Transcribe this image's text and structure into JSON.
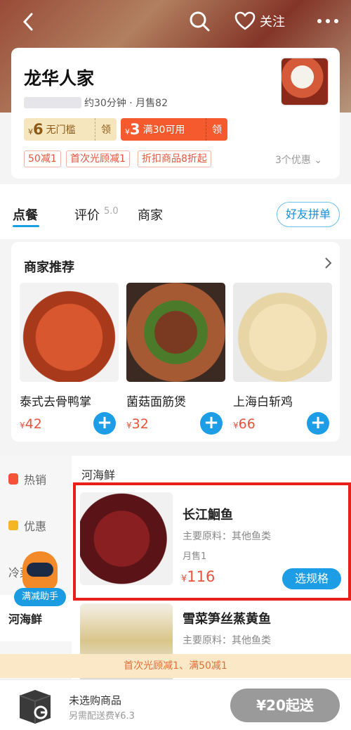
{
  "header": {
    "follow_label": "关注"
  },
  "shop": {
    "name": "龙华人家",
    "delivery_meta": "约30分钟 · 月售82",
    "coupons": [
      {
        "symbol": "¥",
        "amount": "6",
        "label": "无门槛",
        "action": "领"
      },
      {
        "symbol": "¥",
        "amount": "3",
        "label": "满30可用",
        "action": "领"
      }
    ],
    "tags": [
      "50减1",
      "首次光顾减1",
      "折扣商品8折起"
    ],
    "promo_count": "3个优惠"
  },
  "tabs": {
    "order": "点餐",
    "review": "评价",
    "review_score": "5.0",
    "merchant": "商家",
    "group_button": "好友拼单"
  },
  "recommend": {
    "title": "商家推荐",
    "items": [
      {
        "name": "泰式去骨鸭掌",
        "symbol": "¥",
        "price": "42"
      },
      {
        "name": "菌菇面筋煲",
        "symbol": "¥",
        "price": "32"
      },
      {
        "name": "上海白斩鸡",
        "symbol": "¥",
        "price": "66"
      }
    ]
  },
  "sidebar": {
    "items": [
      {
        "label": "热销"
      },
      {
        "label": "优惠"
      },
      {
        "label": "冷菜"
      },
      {
        "label": "河海鲜"
      }
    ],
    "assistant_label": "满减助手"
  },
  "menu": {
    "category": "河海鲜",
    "dishes": [
      {
        "name": "长江鮰鱼",
        "desc": "主要原料：其他鱼类",
        "sold": "月售1",
        "symbol": "¥",
        "price": "116",
        "button": "选规格"
      },
      {
        "name": "雪菜笋丝蒸黄鱼",
        "desc": "主要原料：其他鱼类"
      }
    ]
  },
  "promo_strip": "首次光顾减1、满50减1",
  "cart": {
    "title": "未选购商品",
    "subtitle": "另需配送费¥6.3",
    "checkout": "¥20起送"
  },
  "colors": {
    "accent": "#1d9de6",
    "price": "#e8533b",
    "highlight": "#e8201b"
  }
}
